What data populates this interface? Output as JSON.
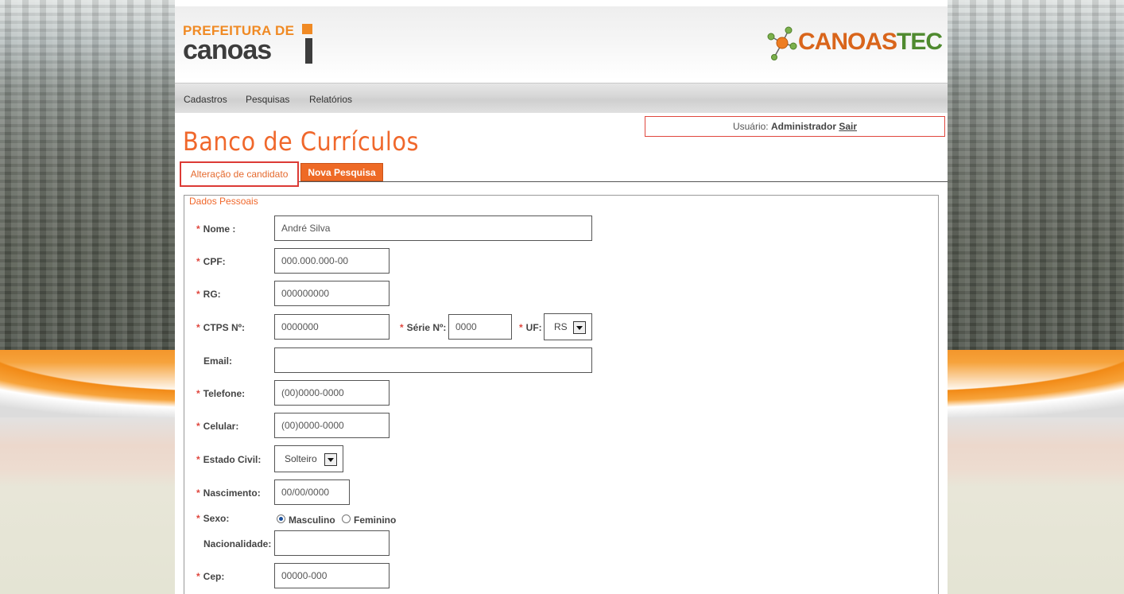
{
  "header": {
    "logo_top": "PREFEITURA DE",
    "logo_bottom": "canoas",
    "brand_a": "CANOAS",
    "brand_b": "TEC"
  },
  "nav": {
    "items": [
      "Cadastros",
      "Pesquisas",
      "Relatórios"
    ]
  },
  "user_box": {
    "prefix": "Usuário:",
    "user": "Administrador",
    "logout": "Sair"
  },
  "page_title": "Banco de Currículos",
  "tabs": {
    "active": "Alteração de candidato",
    "new_search": "Nova Pesquisa"
  },
  "form": {
    "legend": "Dados Pessoais",
    "required_mark": "*",
    "fields": {
      "nome": {
        "label": "Nome :",
        "value": "André Silva"
      },
      "cpf": {
        "label": "CPF:",
        "value": "000.000.000-00"
      },
      "rg": {
        "label": "RG:",
        "value": "000000000"
      },
      "ctps": {
        "label": "CTPS Nº:",
        "value": "0000000"
      },
      "serie": {
        "label": "Série Nº:",
        "value": "0000"
      },
      "uf": {
        "label": "UF:",
        "value": "RS"
      },
      "email": {
        "label": "Email:",
        "value": ""
      },
      "telefone": {
        "label": "Telefone:",
        "value": "(00)0000-0000"
      },
      "celular": {
        "label": "Celular:",
        "value": "(00)0000-0000"
      },
      "estado_civil": {
        "label": "Estado Civil:",
        "value": "Solteiro"
      },
      "nascimento": {
        "label": "Nascimento:",
        "value": "00/00/0000"
      },
      "sexo": {
        "label": "Sexo:",
        "options": [
          "Masculino",
          "Feminino"
        ],
        "selected": "Masculino"
      },
      "nacionalidade": {
        "label": "Nacionalidade:",
        "value": ""
      },
      "cep": {
        "label": "Cep:",
        "value": "00000-000"
      }
    }
  },
  "colors": {
    "accent": "#f0682c",
    "required": "#e0473e",
    "tab_bg": "#ee6a26"
  }
}
